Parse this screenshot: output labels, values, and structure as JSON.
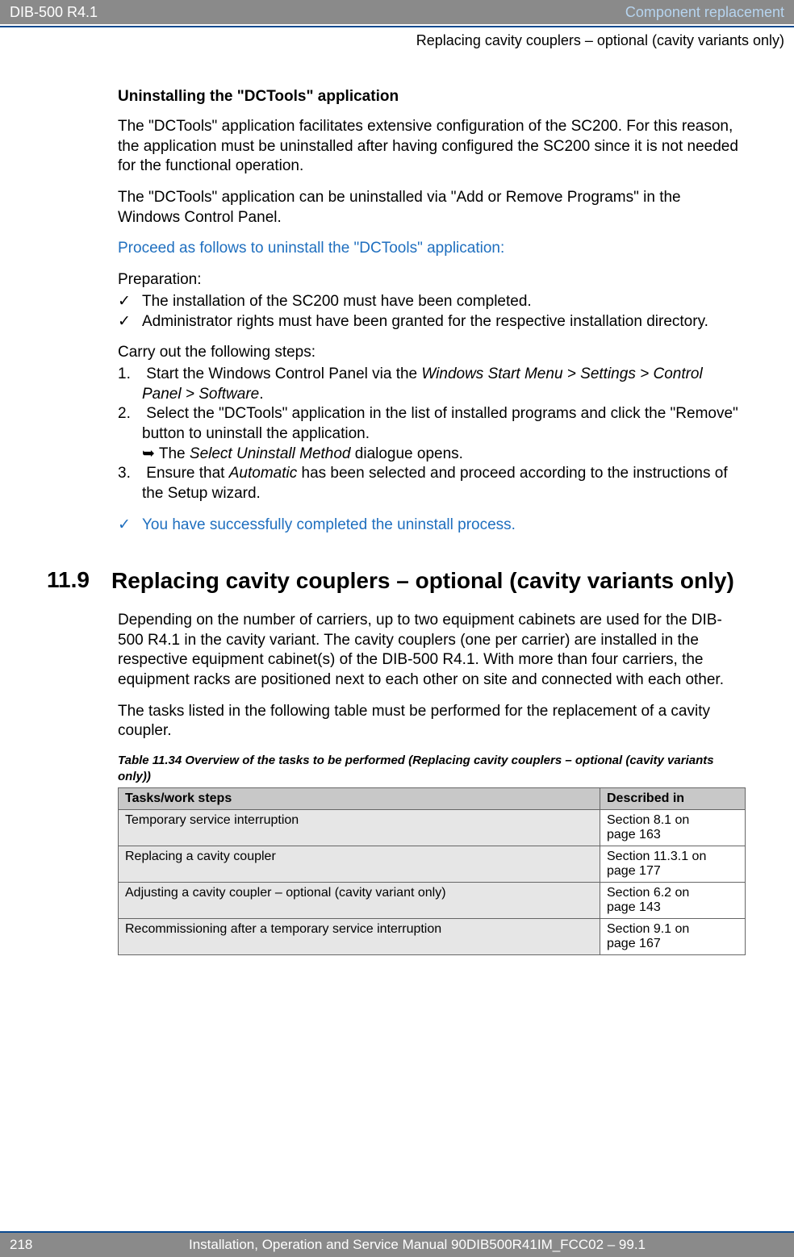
{
  "header": {
    "left": "DIB-500 R4.1",
    "right": "Component replacement",
    "sub": "Replacing cavity couplers – optional (cavity variants only)"
  },
  "uninstall": {
    "heading": "Uninstalling the \"DCTools\" application",
    "p1": "The \"DCTools\" application facilitates extensive configuration of the SC200. For this reason, the application must be uninstalled after having configured the SC200 since it is not needed for the functional operation.",
    "p2": "The \"DCTools\" application can be uninstalled via \"Add or Remove Programs\" in the Windows Control Panel.",
    "proceed": "Proceed as follows to uninstall the \"DCTools\" application:",
    "prep_label": "Preparation:",
    "prep1": "The installation of the SC200 must have been completed.",
    "prep2": "Administrator rights must have been granted for the respective installation directory.",
    "carry": "Carry out the following steps:",
    "step1_a": "Start the Windows Control Panel via the ",
    "step1_i": "Windows Start Menu > Settings > Control Panel > Software",
    "step1_b": ".",
    "step2": "Select the \"DCTools\" application in the list of installed programs and click the \"Remove\" button to uninstall the application.",
    "step2_arrow_a": "The ",
    "step2_arrow_i": "Select Uninstall Method",
    "step2_arrow_b": " dialogue opens.",
    "step3_a": "Ensure that ",
    "step3_i": "Automatic",
    "step3_b": " has been selected and proceed according to the instructions of the Setup wizard.",
    "success": "You have successfully completed the uninstall process."
  },
  "section": {
    "number": "11.9",
    "title": "Replacing cavity couplers – optional (cavity variants only)",
    "p1": "Depending on  the number of carriers, up to two equipment cabinets are used for the DIB-500 R4.1 in the cavity variant. The cavity couplers (one per carrier) are installed in the respective equipment cabinet(s) of the DIB-500 R4.1. With more than four carriers, the equipment racks are positioned next to each other on site and connected with each other.",
    "p2": "The tasks listed in the following table must be performed for the replacement of a cavity coupler."
  },
  "table": {
    "caption_label": "Table 11.34",
    "caption_text": " Overview of the tasks to be performed (Replacing cavity couplers – optional (cavity variants only))",
    "col1": "Tasks/work steps",
    "col2": "Described in",
    "rows": [
      {
        "task": "Temporary service interruption",
        "desc": "Section 8.1 on page 163"
      },
      {
        "task": "Replacing a cavity coupler",
        "desc": "Section 11.3.1 on page 177"
      },
      {
        "task": "Adjusting a cavity coupler – optional (cavity variant only)",
        "desc": "Section 6.2 on page 143"
      },
      {
        "task": "Recommissioning after a temporary service interruption",
        "desc": "Section 9.1 on page 167"
      }
    ]
  },
  "footer": {
    "page": "218",
    "text": "Installation, Operation and Service Manual 90DIB500R41IM_FCC02  –  99.1"
  }
}
